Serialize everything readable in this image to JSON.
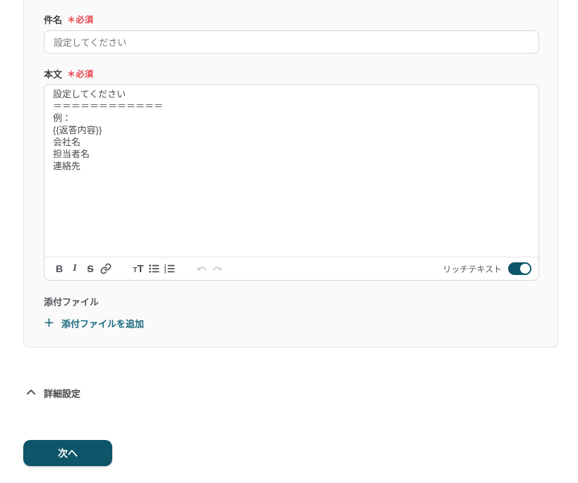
{
  "colors": {
    "accent_teal": "#0e5569",
    "link_teal": "#1a6a7e",
    "required_red": "#e8414b",
    "card_background": "#fafafa"
  },
  "icons": {
    "plus": "＋"
  },
  "form": {
    "subject": {
      "label": "件名",
      "required_badge": "＊必須",
      "value": "設定してください"
    },
    "body": {
      "label": "本文",
      "required_badge": "＊必須",
      "content": "設定してください\n＝＝＝＝＝＝＝＝＝＝＝＝\n例：\n{{返答内容}}\n会社名\n担当者名\n連絡先",
      "toolbar": {
        "bold": "B",
        "italic": "I",
        "strikethrough": "S",
        "heading_small": "T",
        "heading_large": "T",
        "rich_text_label": "リッチテキスト",
        "rich_text_enabled": true
      }
    },
    "attachments": {
      "label": "添付ファイル",
      "add_button_label": "添付ファイルを追加"
    }
  },
  "advanced_settings": {
    "label": "詳細設定",
    "expanded": true
  },
  "next_button_label": "次へ"
}
